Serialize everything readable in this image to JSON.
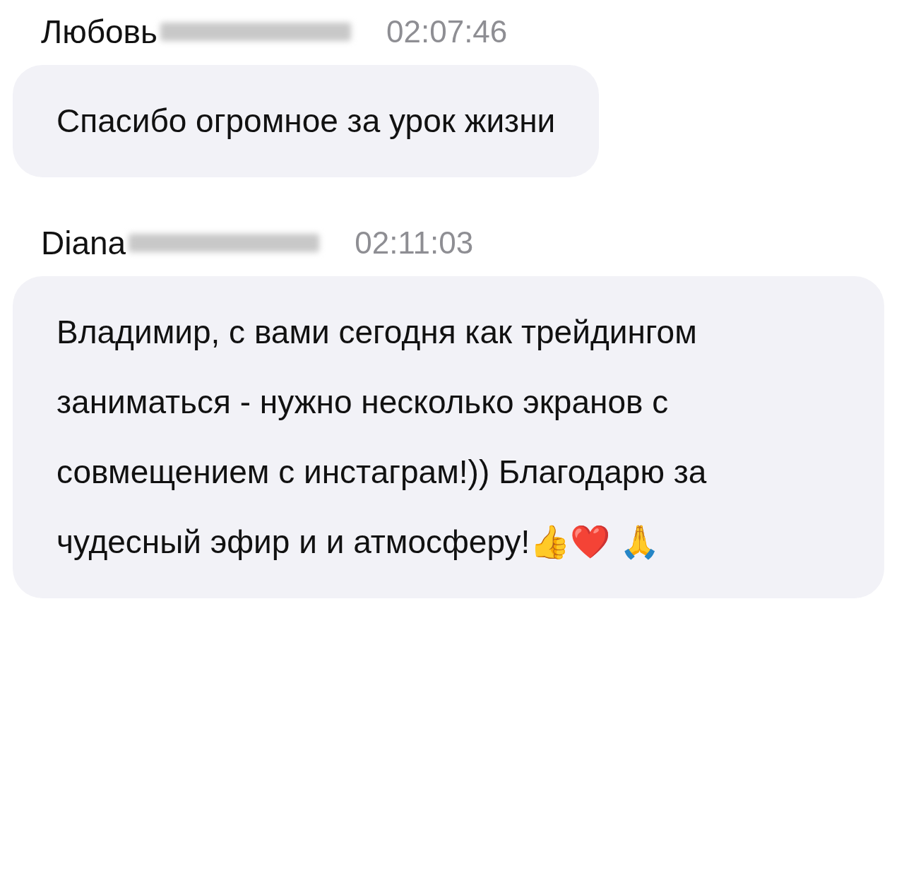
{
  "messages": [
    {
      "author": "Любовь",
      "author_redacted": true,
      "time": "02:07:46",
      "text": "Спасибо огромное за урок жизни"
    },
    {
      "author": "Diana",
      "author_redacted": true,
      "time": "02:11:03",
      "text": "Владимир, с вами сегодня как трейдингом заниматься - нужно несколько экранов с совмещением с инстаграм!)) Благодарю за чудесный эфир и и атмосферу!👍❤️ 🙏"
    }
  ]
}
